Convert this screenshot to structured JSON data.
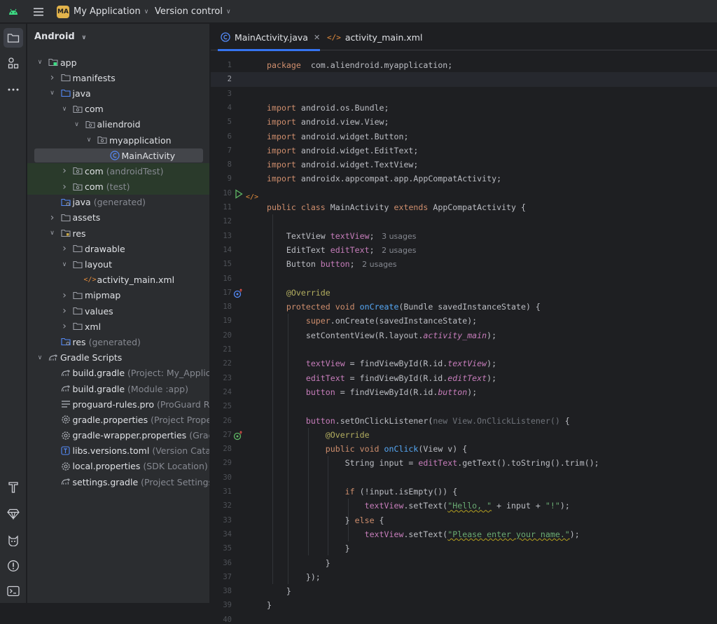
{
  "titlebar": {
    "project_badge": "MA",
    "project_name": "My Application",
    "vcs_label": "Version control"
  },
  "project_panel": {
    "view_label": "Android"
  },
  "tree": [
    {
      "label": "app",
      "secondary": "",
      "depth": 0,
      "arrow": "open",
      "icon": "module-folder-icon"
    },
    {
      "label": "manifests",
      "secondary": "",
      "depth": 1,
      "arrow": "closed",
      "icon": "folder-icon"
    },
    {
      "label": "java",
      "secondary": "",
      "depth": 1,
      "arrow": "open",
      "icon": "source-folder-icon"
    },
    {
      "label": "com",
      "secondary": "",
      "depth": 2,
      "arrow": "open",
      "icon": "package-icon"
    },
    {
      "label": "aliendroid",
      "secondary": "",
      "depth": 3,
      "arrow": "open",
      "icon": "package-icon"
    },
    {
      "label": "myapplication",
      "secondary": "",
      "depth": 4,
      "arrow": "open",
      "icon": "package-icon"
    },
    {
      "label": "MainActivity",
      "secondary": "",
      "depth": 5,
      "arrow": "none",
      "icon": "java-class-icon",
      "selected": true
    },
    {
      "label": "com",
      "secondary": "(androidTest)",
      "depth": 2,
      "arrow": "closed",
      "icon": "package-icon",
      "green": true
    },
    {
      "label": "com",
      "secondary": "(test)",
      "depth": 2,
      "arrow": "closed",
      "icon": "package-icon",
      "green": true
    },
    {
      "label": "java",
      "secondary": "(generated)",
      "depth": 1,
      "arrow": "none",
      "icon": "generated-folder-icon"
    },
    {
      "label": "assets",
      "secondary": "",
      "depth": 1,
      "arrow": "closed",
      "icon": "folder-icon"
    },
    {
      "label": "res",
      "secondary": "",
      "depth": 1,
      "arrow": "open",
      "icon": "res-folder-icon"
    },
    {
      "label": "drawable",
      "secondary": "",
      "depth": 2,
      "arrow": "closed",
      "icon": "folder-icon"
    },
    {
      "label": "layout",
      "secondary": "",
      "depth": 2,
      "arrow": "open",
      "icon": "folder-icon"
    },
    {
      "label": "activity_main.xml",
      "secondary": "",
      "depth": 3,
      "arrow": "none",
      "icon": "xml-file-icon"
    },
    {
      "label": "mipmap",
      "secondary": "",
      "depth": 2,
      "arrow": "closed",
      "icon": "folder-icon"
    },
    {
      "label": "values",
      "secondary": "",
      "depth": 2,
      "arrow": "closed",
      "icon": "folder-icon"
    },
    {
      "label": "xml",
      "secondary": "",
      "depth": 2,
      "arrow": "closed",
      "icon": "folder-icon"
    },
    {
      "label": "res",
      "secondary": "(generated)",
      "depth": 1,
      "arrow": "none",
      "icon": "generated-folder-icon"
    },
    {
      "label": "Gradle Scripts",
      "secondary": "",
      "depth": 0,
      "arrow": "open",
      "icon": "gradle-icon"
    },
    {
      "label": "build.gradle",
      "secondary": "(Project: My_Applicatio",
      "depth": 1,
      "arrow": "none",
      "icon": "gradle-icon"
    },
    {
      "label": "build.gradle",
      "secondary": "(Module :app)",
      "depth": 1,
      "arrow": "none",
      "icon": "gradle-icon"
    },
    {
      "label": "proguard-rules.pro",
      "secondary": "(ProGuard Rule",
      "depth": 1,
      "arrow": "none",
      "icon": "text-file-icon"
    },
    {
      "label": "gradle.properties",
      "secondary": "(Project Properti",
      "depth": 1,
      "arrow": "none",
      "icon": "settings-file-icon"
    },
    {
      "label": "gradle-wrapper.properties",
      "secondary": "(Gradle",
      "depth": 1,
      "arrow": "none",
      "icon": "settings-file-icon"
    },
    {
      "label": "libs.versions.toml",
      "secondary": "(Version Catalog",
      "depth": 1,
      "arrow": "none",
      "icon": "toml-file-icon"
    },
    {
      "label": "local.properties",
      "secondary": "(SDK Location)",
      "depth": 1,
      "arrow": "none",
      "icon": "settings-file-icon"
    },
    {
      "label": "settings.gradle",
      "secondary": "(Project Settings)",
      "depth": 1,
      "arrow": "none",
      "icon": "gradle-icon"
    }
  ],
  "tabs": [
    {
      "label": "MainActivity.java",
      "icon": "java-class-icon",
      "active": true
    },
    {
      "label": "activity_main.xml",
      "icon": "xml-file-icon",
      "active": false
    }
  ],
  "editor": {
    "current_line": 2,
    "lines": [
      [
        [
          "kw",
          "package"
        ],
        [
          "",
          "  com.aliendroid.myapplication;"
        ]
      ],
      [],
      [],
      [
        [
          "kw",
          "import"
        ],
        [
          "",
          " android.os.Bundle;"
        ]
      ],
      [
        [
          "kw",
          "import"
        ],
        [
          "",
          " android.view.View;"
        ]
      ],
      [
        [
          "kw",
          "import"
        ],
        [
          "",
          " android.widget.Button;"
        ]
      ],
      [
        [
          "kw",
          "import"
        ],
        [
          "",
          " android.widget.EditText;"
        ]
      ],
      [
        [
          "kw",
          "import"
        ],
        [
          "",
          " android.widget.TextView;"
        ]
      ],
      [
        [
          "kw",
          "import"
        ],
        [
          "",
          " androidx.appcompat.app.AppCompatActivity;"
        ]
      ],
      [],
      [
        [
          "kw",
          "public class"
        ],
        [
          "",
          " MainActivity "
        ],
        [
          "kw",
          "extends"
        ],
        [
          "",
          " AppCompatActivity {"
        ]
      ],
      [],
      [
        [
          "",
          "    TextView "
        ],
        [
          "fld",
          "textView"
        ],
        [
          "",
          ";"
        ],
        [
          "hint",
          "   3 usages"
        ]
      ],
      [
        [
          "",
          "    EditText "
        ],
        [
          "fld",
          "editText"
        ],
        [
          "",
          ";"
        ],
        [
          "hint",
          "   2 usages"
        ]
      ],
      [
        [
          "",
          "    Button "
        ],
        [
          "fld",
          "button"
        ],
        [
          "",
          ";"
        ],
        [
          "hint",
          "   2 usages"
        ]
      ],
      [],
      [
        [
          "ann",
          "    @Override"
        ]
      ],
      [
        [
          "kw",
          "    protected void "
        ],
        [
          "fn",
          "onCreate"
        ],
        [
          "",
          "(Bundle savedInstanceState) {"
        ]
      ],
      [
        [
          "kw",
          "        super"
        ],
        [
          "",
          ".onCreate(savedInstanceState);"
        ]
      ],
      [
        [
          "",
          "        setContentView(R.layout."
        ],
        [
          "fld it",
          "activity_main"
        ],
        [
          "",
          ");"
        ]
      ],
      [],
      [
        [
          "fld",
          "        textView"
        ],
        [
          "",
          " = findViewById(R.id."
        ],
        [
          "fld it",
          "textView"
        ],
        [
          "",
          ");"
        ]
      ],
      [
        [
          "fld",
          "        editText"
        ],
        [
          "",
          " = findViewById(R.id."
        ],
        [
          "fld it",
          "editText"
        ],
        [
          "",
          ");"
        ]
      ],
      [
        [
          "fld",
          "        button"
        ],
        [
          "",
          " = findViewById(R.id."
        ],
        [
          "fld it",
          "button"
        ],
        [
          "",
          ");"
        ]
      ],
      [],
      [
        [
          "fld",
          "        button"
        ],
        [
          "",
          ".setOnClickListener("
        ],
        [
          "anon",
          "new View.OnClickListener()"
        ],
        [
          "",
          " {"
        ]
      ],
      [
        [
          "ann",
          "            @Override"
        ]
      ],
      [
        [
          "kw",
          "            public void "
        ],
        [
          "fn",
          "onClick"
        ],
        [
          "",
          "(View v) {"
        ]
      ],
      [
        [
          "",
          "                String input = "
        ],
        [
          "fld",
          "editText"
        ],
        [
          "",
          ".getText().toString().trim();"
        ]
      ],
      [],
      [
        [
          "kw",
          "                if"
        ],
        [
          "",
          " (!input.isEmpty()) {"
        ]
      ],
      [
        [
          "fld",
          "                    textView"
        ],
        [
          "",
          ".setText("
        ],
        [
          "str wavy",
          "\"Hello, \""
        ],
        [
          "",
          " + input + "
        ],
        [
          "str",
          "\"!\""
        ],
        [
          "",
          ");"
        ]
      ],
      [
        [
          "",
          "                } "
        ],
        [
          "kw",
          "else"
        ],
        [
          "",
          " {"
        ]
      ],
      [
        [
          "fld",
          "                    textView"
        ],
        [
          "",
          ".setText("
        ],
        [
          "str wavy",
          "\"Please enter your name.\""
        ],
        [
          "",
          ");"
        ]
      ],
      [
        [
          "",
          "                }"
        ]
      ],
      [
        [
          "",
          "            }"
        ]
      ],
      [
        [
          "",
          "        });"
        ]
      ],
      [
        [
          "",
          "    }"
        ]
      ],
      [
        [
          "",
          "}"
        ]
      ],
      []
    ]
  },
  "colors": {
    "accent": "#3574f0",
    "keyword": "#cf8e6d",
    "function": "#56a8f5",
    "field": "#c77dbb",
    "string": "#6aab73",
    "annotation": "#b3ae60"
  }
}
